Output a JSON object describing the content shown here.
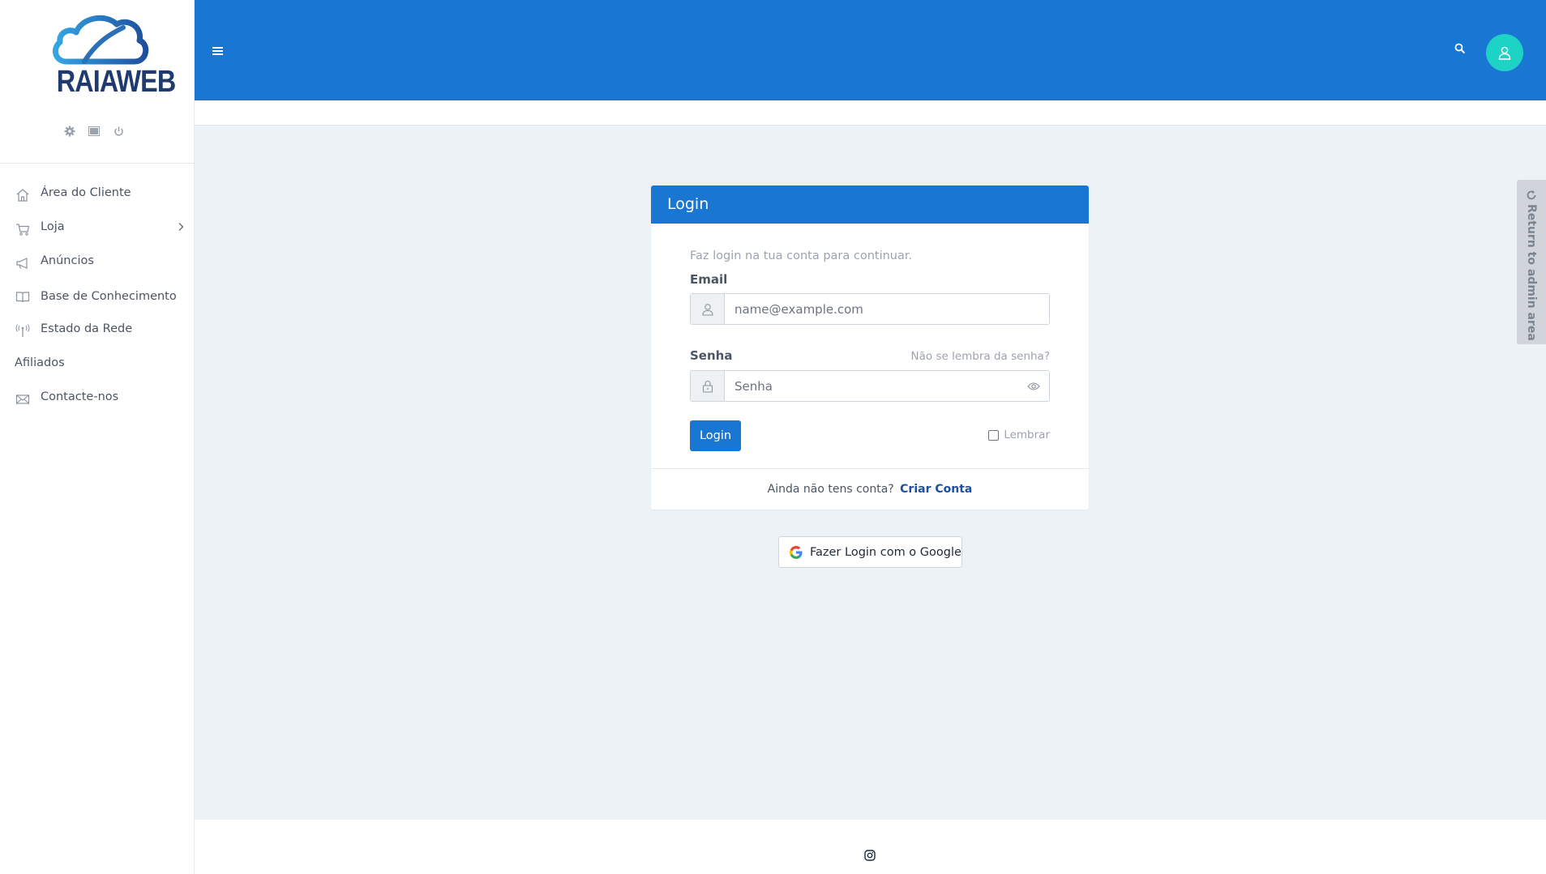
{
  "brand": {
    "name": "RAIAWEB"
  },
  "sidebar": {
    "tools": [
      "gear-icon",
      "image-icon",
      "power-icon"
    ],
    "items": [
      {
        "label": "Área do Cliente",
        "icon": "home-icon"
      },
      {
        "label": "Loja",
        "icon": "cart-icon",
        "has_submenu": true
      },
      {
        "label": "Anúncios",
        "icon": "megaphone-icon"
      },
      {
        "label": "Base de Conhecimento",
        "icon": "book-icon"
      },
      {
        "label": "Estado da Rede",
        "icon": "antenna-icon"
      },
      {
        "label": "Afiliados",
        "icon": ""
      },
      {
        "label": "Contacte-nos",
        "icon": "envelope-icon"
      }
    ]
  },
  "side_tab": {
    "label": "Return to admin area"
  },
  "login": {
    "title": "Login",
    "hint": "Faz login na tua conta para continuar.",
    "email_label": "Email",
    "email_placeholder": "name@example.com",
    "password_label": "Senha",
    "password_placeholder": "Senha",
    "forgot_link": "Não se lembra da senha?",
    "submit_label": "Login",
    "remember_label": "Lembrar",
    "no_account_text": "Ainda não tens conta?",
    "create_account_link": "Criar Conta"
  },
  "google_button": {
    "label": "Fazer Login com o Google"
  },
  "colors": {
    "primary": "#1976d2",
    "avatar": "#1dd3c5",
    "background": "#ecf2f6"
  }
}
